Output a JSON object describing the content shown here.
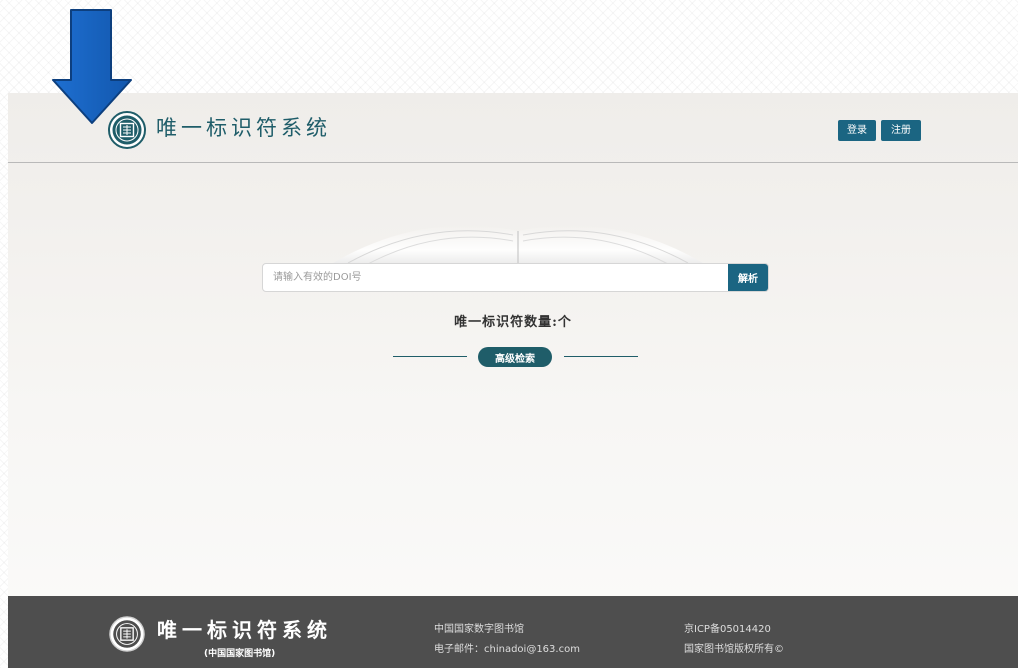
{
  "header": {
    "site_title": "唯一标识符系统",
    "login_label": "登录",
    "register_label": "注册"
  },
  "search": {
    "placeholder": "请输入有效的DOI号",
    "button_label": "解析"
  },
  "stats": {
    "count_label": "唯一标识符数量:个"
  },
  "advanced_search": {
    "label": "高级检索"
  },
  "footer": {
    "site_title": "唯一标识符系统",
    "subtitle": "(中国国家图书馆)",
    "library_name": "中国国家数字图书馆",
    "email": "电子邮件：chinadoi@163.com",
    "icp": "京ICP备05014420",
    "copyright": "国家图书馆版权所有©"
  },
  "colors": {
    "accent": "#1b6582",
    "title_teal": "#1f5d69",
    "footer_bg": "#4e4e4e",
    "arrow_blue": "#1565c0"
  },
  "icons": {
    "logo": "library-seal-icon",
    "annotation": "down-arrow-icon"
  }
}
